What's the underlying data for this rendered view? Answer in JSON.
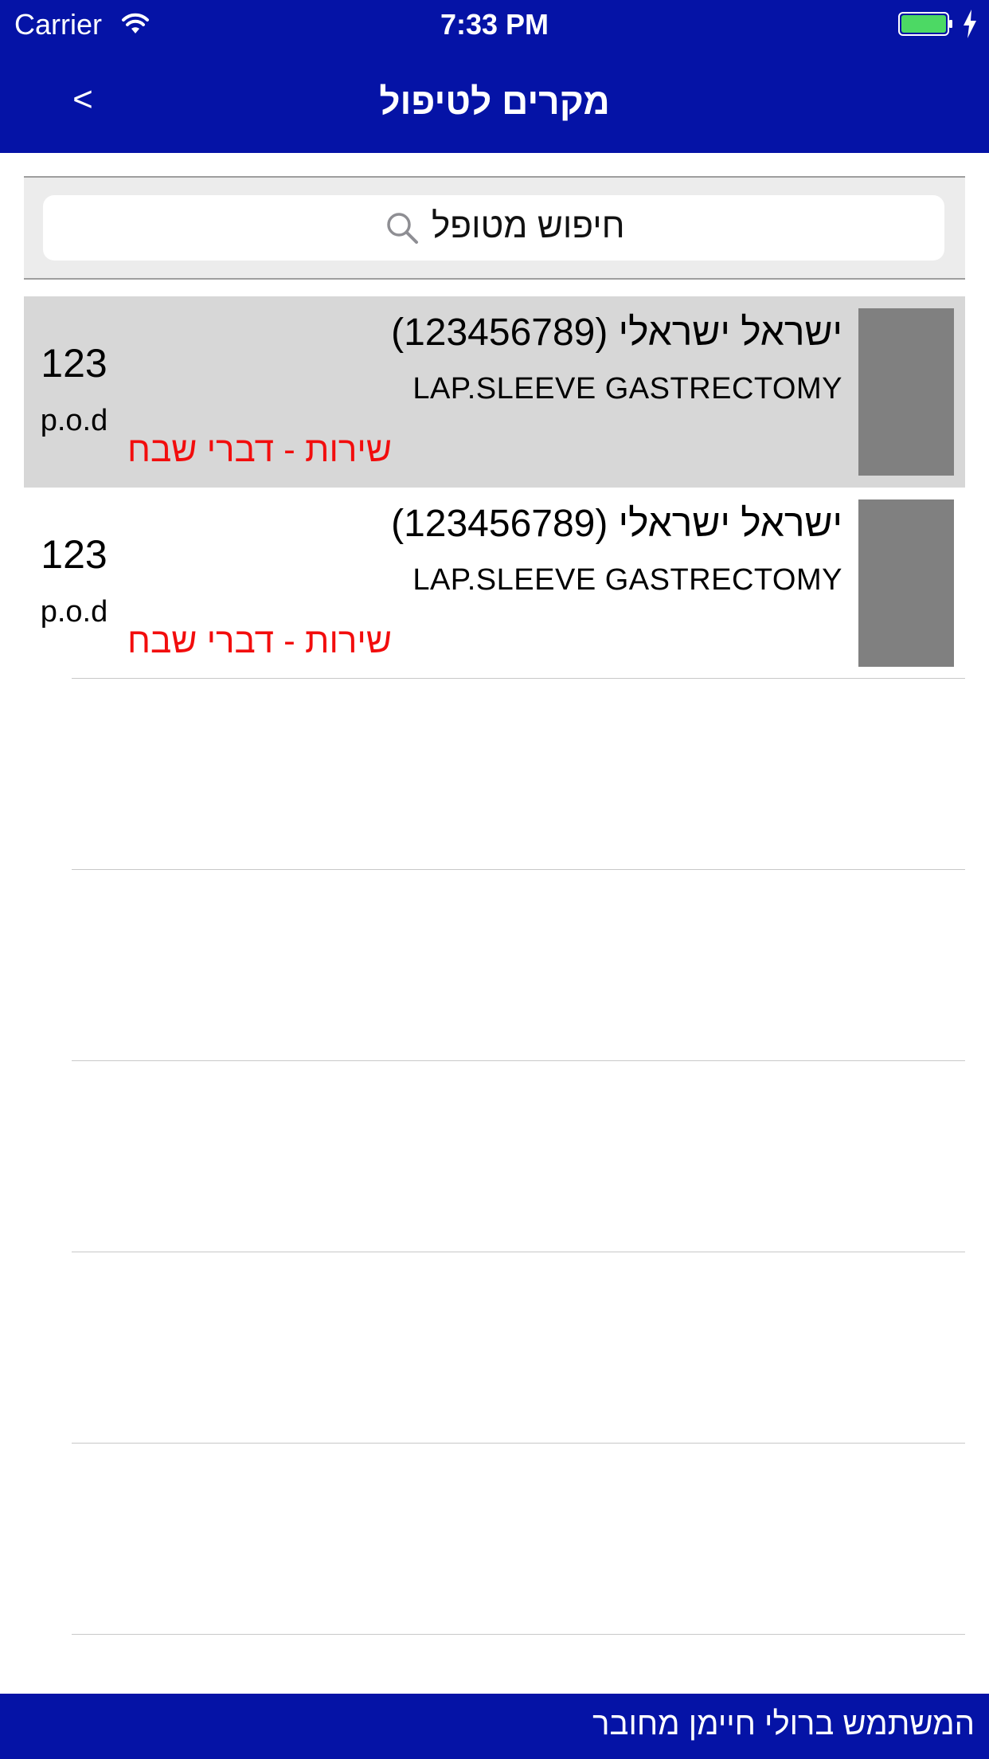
{
  "status_bar": {
    "carrier": "Carrier",
    "time": "7:33 PM",
    "battery_color": "#4cd964"
  },
  "nav": {
    "back_label": "<",
    "title": "מקרים לטיפול"
  },
  "search": {
    "placeholder": "חיפוש מטופל",
    "icon": "search-icon"
  },
  "cases": [
    {
      "name": "ישראל ישראלי (123456789)",
      "procedure": "LAP.SLEEVE GASTRECTOMY",
      "service": "שירות - דברי שבח",
      "count": "123",
      "unit": "p.o.d",
      "selected": true
    },
    {
      "name": "ישראל ישראלי (123456789)",
      "procedure": "LAP.SLEEVE GASTRECTOMY",
      "service": "שירות - דברי שבח",
      "count": "123",
      "unit": "p.o.d",
      "selected": false
    }
  ],
  "footer": {
    "text": "המשתמש ברולי חיימן מחובר"
  },
  "colors": {
    "brand": "#0513a6",
    "service_text": "#f20d0d",
    "selected_row": "#d7d7d7",
    "thumbnail": "#808080"
  }
}
